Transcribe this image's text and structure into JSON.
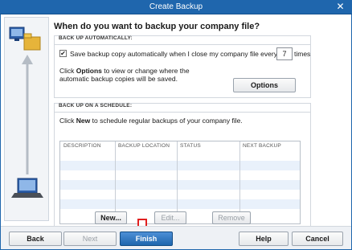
{
  "window": {
    "title": "Create Backup",
    "close_glyph": "✕"
  },
  "heading": "When do you want to backup your company file?",
  "auto_backup": {
    "section_title": "BACK UP AUTOMATICALLY:",
    "checkbox_checked": true,
    "checkbox_label": "Save backup copy automatically when I close my company file every",
    "times_value": "7",
    "times_label": "times",
    "info_pre": "Click ",
    "info_bold": "Options",
    "info_post": " to view or change where the automatic backup copies will be saved.",
    "options_button": "Options"
  },
  "schedule": {
    "section_title": "BACK UP ON A SCHEDULE:",
    "text_pre": "Click ",
    "text_bold": "New",
    "text_post": " to schedule regular backups of your company file.",
    "columns": [
      "DESCRIPTION",
      "BACKUP LOCATION",
      "STATUS",
      "NEXT BACKUP"
    ],
    "new_button": "New...",
    "edit_button": "Edit...",
    "remove_button": "Remove"
  },
  "footer": {
    "back": "Back",
    "next": "Next",
    "finish": "Finish",
    "help": "Help",
    "cancel": "Cancel"
  },
  "colors": {
    "title_bar": "#1f66ad",
    "primary_button": "#1f66ad",
    "highlight_arrow": "#e02020",
    "alt_row": "#e9f1fb"
  },
  "icons": [
    "close-icon",
    "computer-backup-illustration",
    "checkbox-checked-icon",
    "down-arrow-icon"
  ]
}
